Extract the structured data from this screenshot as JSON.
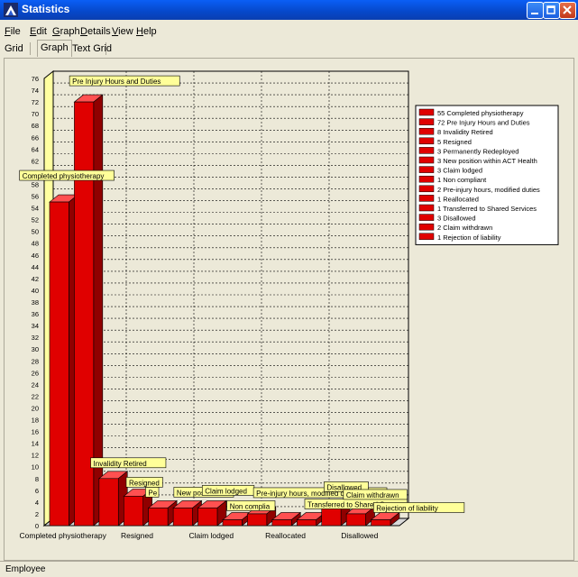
{
  "window": {
    "title": "Statistics"
  },
  "menu": [
    "File",
    "Edit",
    "Graph",
    "Details",
    "View",
    "Help"
  ],
  "tabs": [
    "Grid",
    "Graph",
    "Text Grid"
  ],
  "active_tab": "Graph",
  "status": "Employee",
  "chart_data": {
    "type": "bar",
    "categories": [
      "Completed physiotherapy",
      "Pre Injury Hours and Duties",
      "Invalidity Retired",
      "Resigned",
      "Permanently Redeployed",
      "New position within ACT Health",
      "Claim lodged",
      "Non compliant",
      "Pre-injury hours, modified duties",
      "Reallocated",
      "Transferred to Shared Services",
      "Disallowed",
      "Claim withdrawn",
      "Rejection of liability"
    ],
    "values": [
      55,
      72,
      8,
      5,
      3,
      3,
      3,
      1,
      2,
      1,
      1,
      3,
      2,
      1
    ],
    "x_tick_labels": [
      "Completed physiotherapy",
      "Resigned",
      "Claim lodged",
      "Reallocated",
      "Disallowed"
    ],
    "legend": [
      "55 Completed physiotherapy",
      "72 Pre Injury Hours and Duties",
      "8 Invalidity Retired",
      "5 Resigned",
      "3 Permanently Redeployed",
      "3 New position within ACT Health",
      "3 Claim lodged",
      "1 Non compliant",
      "2 Pre-injury hours, modified duties",
      "1 Reallocated",
      "1 Transferred to Shared Services",
      "3 Disallowed",
      "2 Claim withdrawn",
      "1 Rejection of liability"
    ],
    "bar_tooltips": [
      "Completed physiotherapy",
      "Pre Injury Hours and Duties",
      "Invalidity Retired",
      "Resigned",
      "Pe",
      "New position w",
      "Claim lodged",
      "Non complia",
      "Pre-injury hours, modified duties",
      "",
      "Transferred to Shared Ser",
      "Disallowed",
      "Claim withdrawn",
      "Rejection of liability"
    ],
    "ylim": [
      0,
      76
    ],
    "ytick_step": 2,
    "grid": true,
    "bar_color": "#e00000",
    "legend_position": "right"
  }
}
